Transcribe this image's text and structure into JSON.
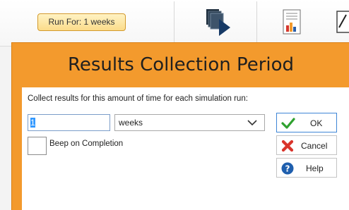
{
  "ribbon": {
    "run_for_label": "Run For: 1 weeks",
    "icons": [
      "run-simulation-icon",
      "report-chart-icon",
      "chart-edit-icon"
    ]
  },
  "dialog": {
    "title": "Results Collection Period",
    "instruction": "Collect results for this amount of time for each simulation run:",
    "quantity_value": "1",
    "unit_selected": "weeks",
    "beep_label": "Beep on Completion",
    "beep_checked": false,
    "buttons": {
      "ok": "OK",
      "cancel": "Cancel",
      "help": "Help"
    }
  },
  "colors": {
    "dialog_frame": "#f39a2d",
    "run_for_bg": "#fbdc8a",
    "ok_check": "#2fa12f",
    "cancel_x": "#d9342b",
    "help_circle": "#1f5fae"
  }
}
